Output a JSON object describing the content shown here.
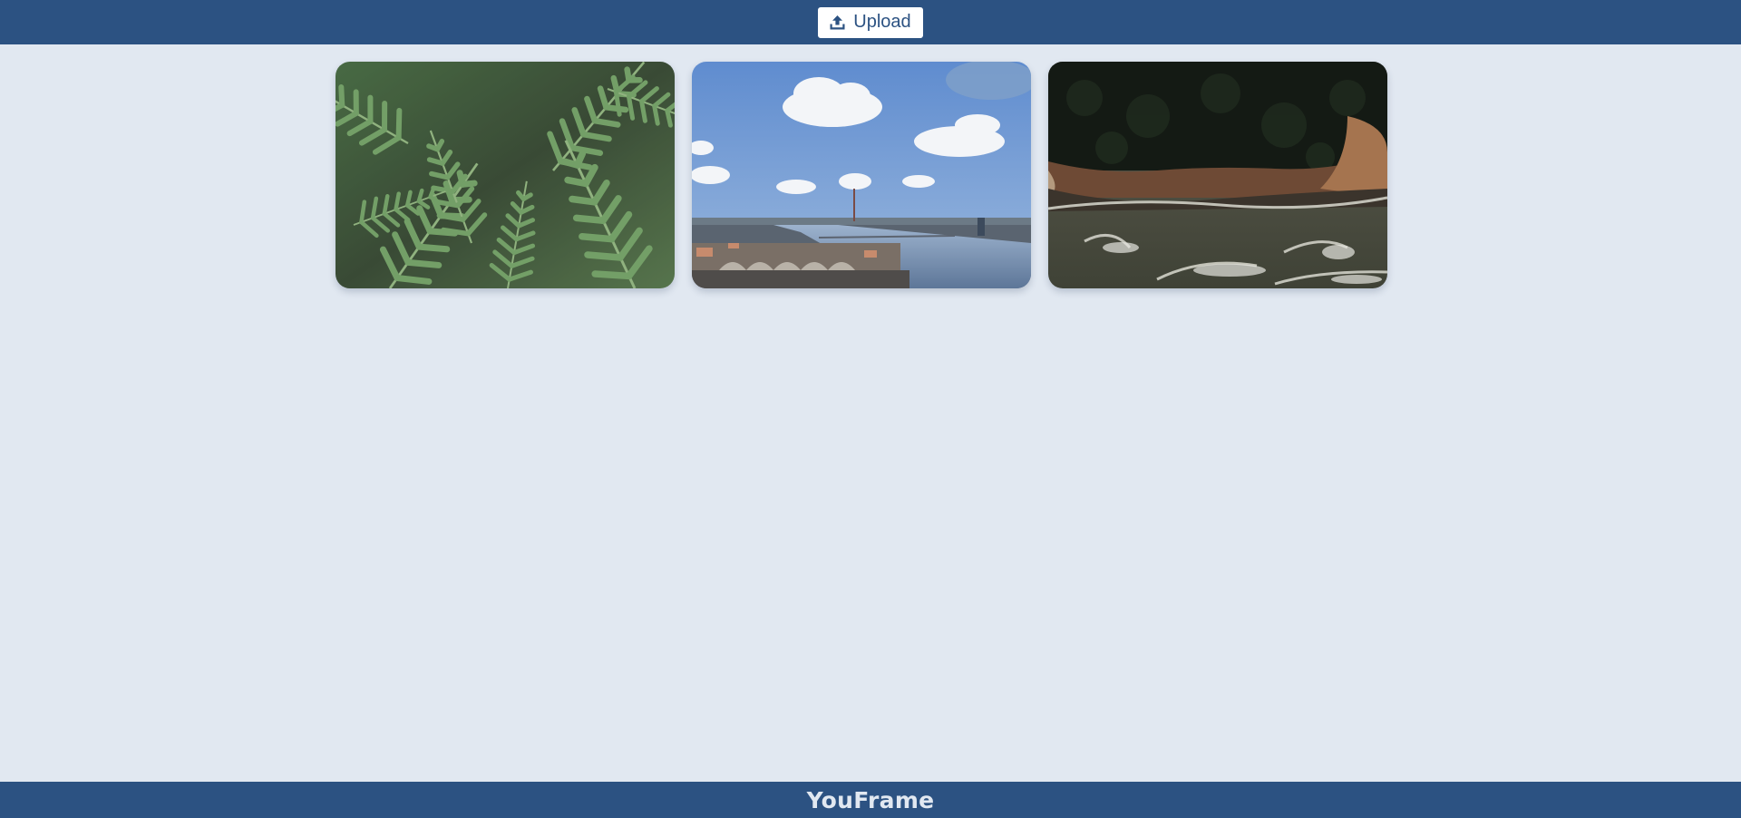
{
  "header": {
    "upload_label": "Upload",
    "upload_icon": "upload-icon"
  },
  "gallery": {
    "images": [
      {
        "subject": "fern-leaves"
      },
      {
        "subject": "city-river-skyline"
      },
      {
        "subject": "aerial-coastline"
      }
    ]
  },
  "footer": {
    "brand": "YouFrame"
  },
  "colors": {
    "bar": "#2c5282",
    "background": "#e1e8f1",
    "button_bg": "#ffffff",
    "button_text": "#2c5282"
  }
}
